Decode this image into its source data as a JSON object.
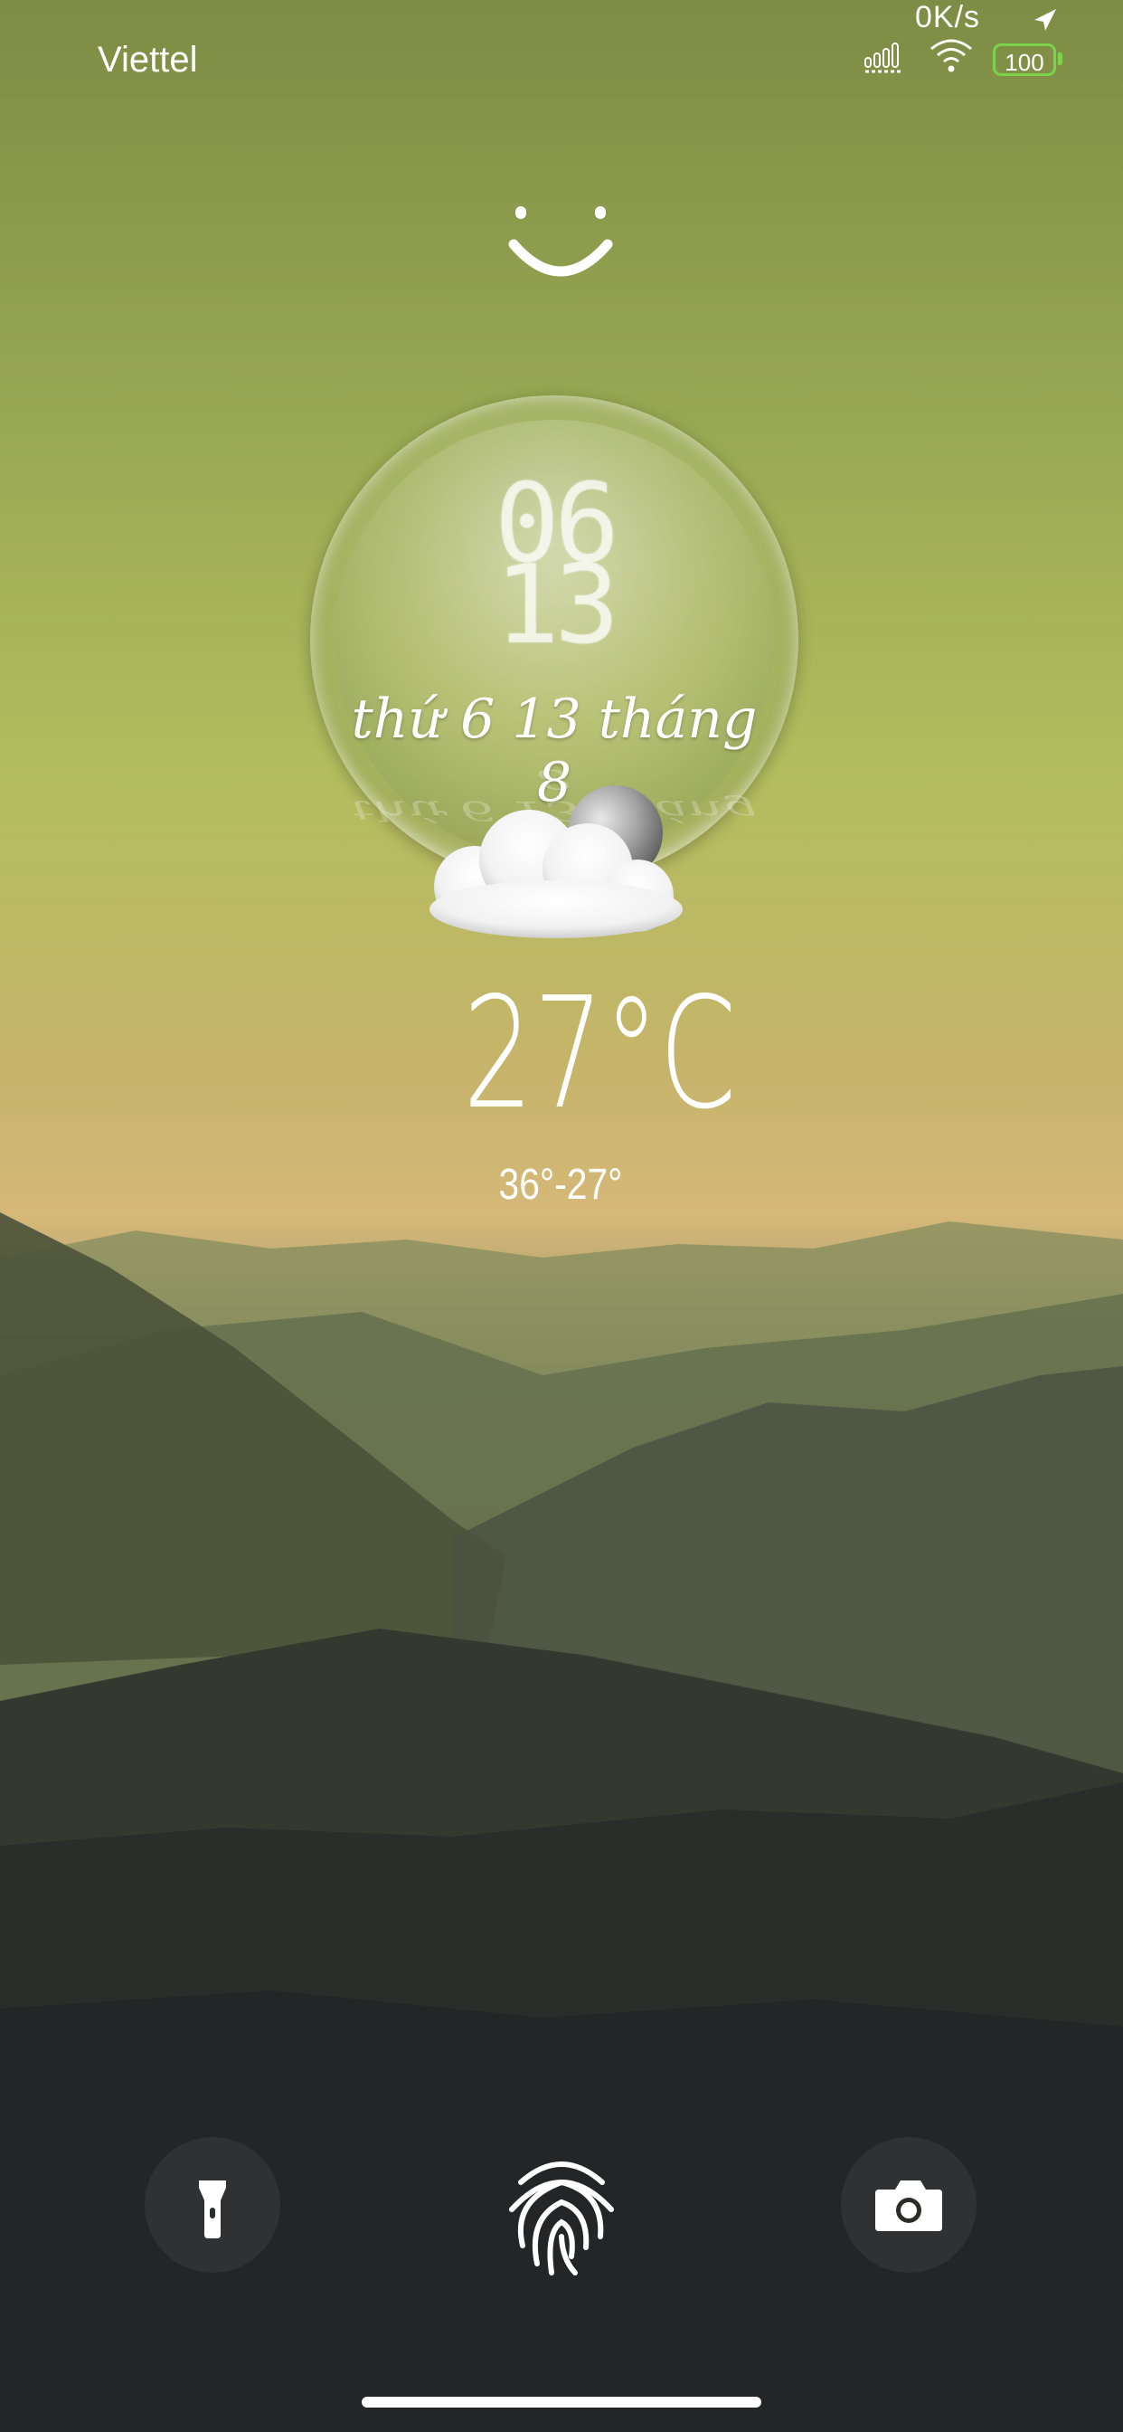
{
  "status_bar": {
    "carrier": "Viettel",
    "speed": "0K/s",
    "battery": "100",
    "icons": [
      "signal-icon",
      "wifi-icon",
      "battery-icon",
      "location-arrow-icon"
    ]
  },
  "lockscreen": {
    "hour": "06",
    "minute": "13",
    "date": "thứ 6 13 tháng 8",
    "temperature": "27°C",
    "temp_range": "36°-27°",
    "weather_icon": "cloudy-night-icon"
  },
  "controls": {
    "left": "flashlight-icon",
    "center": "fingerprint-icon",
    "right": "camera-icon"
  },
  "colors": {
    "sky_top": "#7e8c45",
    "sky_mid": "#c6b46a",
    "battery_green": "#7ad44b",
    "ground": "#1f2123"
  }
}
